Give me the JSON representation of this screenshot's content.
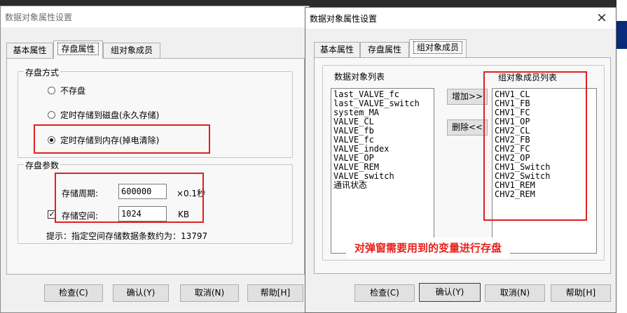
{
  "left_window": {
    "title": "数据对象属性设置",
    "tabs": [
      {
        "label": "基本属性"
      },
      {
        "label": "存盘属性"
      },
      {
        "label": "组对象成员"
      }
    ],
    "storage_mode": {
      "label": "存盘方式",
      "options": [
        {
          "label": "不存盘",
          "selected": false
        },
        {
          "label": "定时存储到磁盘(永久存储)",
          "selected": false
        },
        {
          "label": "定时存储到内存(掉电清除)",
          "selected": true
        }
      ]
    },
    "storage_params": {
      "label": "存盘参数",
      "period_label": "存储周期:",
      "period_value": "600000",
      "period_unit": "×0.1秒",
      "space_checked": true,
      "space_check_mark": "✓",
      "space_label": "存储空间:",
      "space_value": "1024",
      "space_unit": "KB",
      "hint": "提示：指定空间存储数据条数约为：13797"
    },
    "buttons": {
      "check": "检查(C)",
      "ok": "确认(Y)",
      "cancel": "取消(N)",
      "help": "帮助[H]"
    }
  },
  "right_window": {
    "title": "数据对象属性设置",
    "close_glyph": "×",
    "tabs": [
      {
        "label": "基本属性"
      },
      {
        "label": "存盘属性"
      },
      {
        "label": "组对象成员"
      }
    ],
    "object_list_label": "数据对象列表",
    "object_list": [
      "last_VALVE_fc",
      "last_VALVE_switch",
      "system_MA",
      "VALVE_CL",
      "VALVE_fb",
      "VALVE_fc",
      "VALVE_index",
      "VALVE_OP",
      "VALVE_REM",
      "VALVE_switch",
      "通讯状态"
    ],
    "add_button": "增加>>",
    "remove_button": "删除<<",
    "member_list_label": "组对象成员列表",
    "member_list": [
      "CHV1_CL",
      "CHV1_FB",
      "CHV1_FC",
      "CHV1_OP",
      "CHV2_CL",
      "CHV2_FB",
      "CHV2_FC",
      "CHV2_OP",
      "CHV1_Switch",
      "CHV2_Switch",
      "CHV1_REM",
      "CHV2_REM"
    ],
    "annotation": "对弹窗需要用到的变量进行存盘",
    "buttons": {
      "check": "检查(C)",
      "ok": "确认(Y)",
      "cancel": "取消(N)",
      "help": "帮助[H]"
    }
  },
  "colors": {
    "highlight_box": "#e02020",
    "annotation_text": "#e8201a"
  }
}
